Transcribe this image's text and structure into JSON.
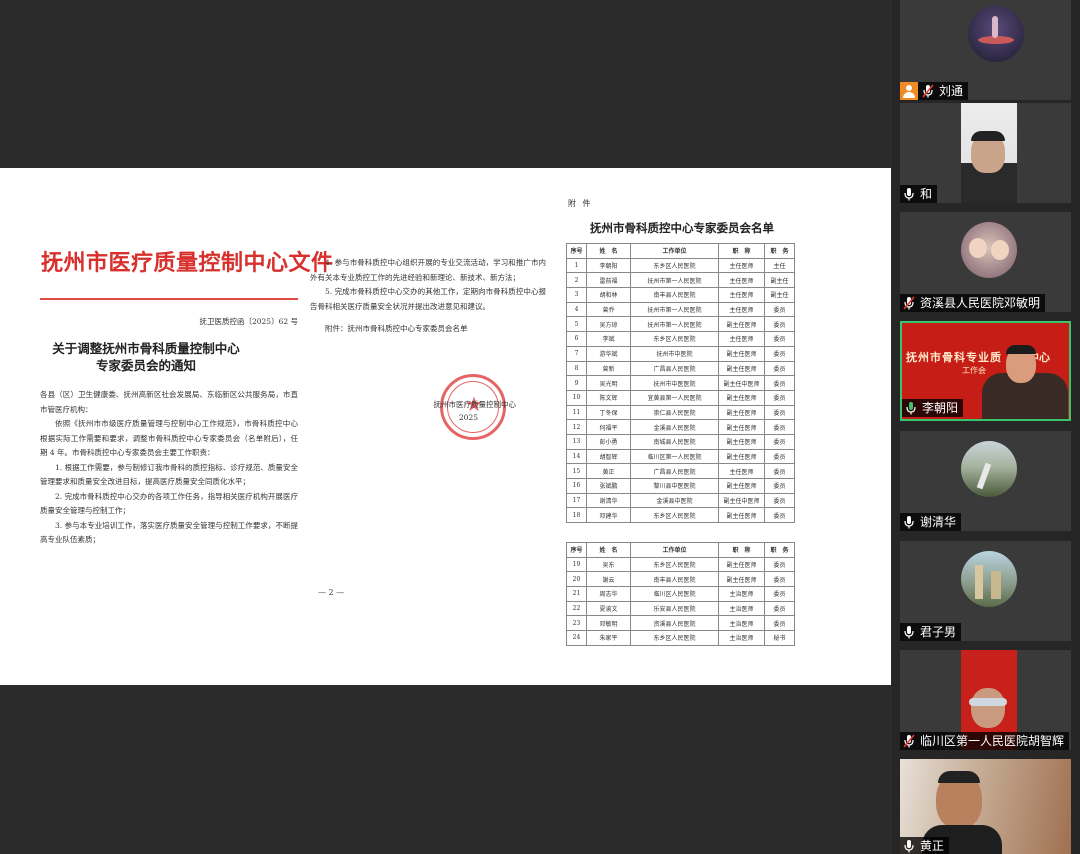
{
  "document": {
    "header_title": "抚州市医疗质量控制中心文件",
    "doc_number": "抚卫医质控函〔2025〕62 号",
    "notice_title_line1": "关于调整抚州市骨科质量控制中心",
    "notice_title_line2": "专家委员会的通知",
    "addressee": "各县（区）卫生健康委、抚州高新区社会发展局、东临新区公共服务局，市直市管医疗机构：",
    "para1": "依照《抚州市市级医疗质量管理与控制中心工作规范》，市骨科质控中心根据实际工作需要和要求，调整市骨科质控中心专家委员会（名单附后），任期 4 年。市骨科质控中心专家委员会主要工作职责：",
    "duty1": "1. 根据工作需要，参与制修订我市骨科的质控指标、诊疗规范、质量安全管理要求和质量安全改进目标，提高医疗质量安全同质化水平；",
    "duty2": "2. 完成市骨科质控中心交办的各项工作任务，指导相关医疗机构开展医疗质量安全管理与控制工作；",
    "duty3": "3. 参与本专业培训工作，落实医疗质量安全管理与控制工作要求，不断提高专业队伍素质；",
    "duty4": "4. 参与市骨科质控中心组织开展的专业交流活动，学习和推广市内外有关本专业质控工作的先进经验和新理论、新技术、新方法；",
    "duty5": "5. 完成市骨科质控中心交办的其他工作，定期向市骨科质控中心报告骨科相关医疗质量安全状况并提出改进意见和建议。",
    "attachment_line": "附件：抚州市骨科质控中心专家委员会名单",
    "signature": "抚州市医疗质量控制中心",
    "sign_date": "2025",
    "page_number": "— 2 —"
  },
  "roster": {
    "attach_label": "附 件",
    "title": "抚州市骨科质控中心专家委员会名单",
    "headers": [
      "序号",
      "姓　名",
      "工作单位",
      "职　称",
      "职　务"
    ],
    "rows1": [
      [
        "1",
        "李朝阳",
        "东乡区人民医院",
        "主任医师",
        "主任"
      ],
      [
        "2",
        "雷前福",
        "抚州市第一人民医院",
        "主任医师",
        "副主任"
      ],
      [
        "3",
        "胡和林",
        "南丰县人民医院",
        "主任医师",
        "副主任"
      ],
      [
        "4",
        "曾乔",
        "抚州市第一人民医院",
        "主任医师",
        "委员"
      ],
      [
        "5",
        "吴方琼",
        "抚州市第一人民医院",
        "副主任医师",
        "委员"
      ],
      [
        "6",
        "李斌",
        "东乡区人民医院",
        "主任医师",
        "委员"
      ],
      [
        "7",
        "游华斌",
        "抚州市中医院",
        "副主任医师",
        "委员"
      ],
      [
        "8",
        "曾新",
        "广昌县人民医院",
        "副主任医师",
        "委员"
      ],
      [
        "9",
        "吴光明",
        "抚州市中医医院",
        "副主任中医师",
        "委员"
      ],
      [
        "10",
        "陈文辉",
        "宜黄县第一人民医院",
        "副主任医师",
        "委员"
      ],
      [
        "11",
        "丁冬保",
        "崇仁县人民医院",
        "副主任医师",
        "委员"
      ],
      [
        "12",
        "何福平",
        "金溪县人民医院",
        "副主任医师",
        "委员"
      ],
      [
        "13",
        "彭小勇",
        "南城县人民医院",
        "副主任医师",
        "委员"
      ],
      [
        "14",
        "胡智辉",
        "临川区第一人民医院",
        "副主任医师",
        "委员"
      ],
      [
        "15",
        "黄正",
        "广昌县人民医院",
        "主任医师",
        "委员"
      ],
      [
        "16",
        "张斌鹏",
        "黎川县中医医院",
        "副主任医师",
        "委员"
      ],
      [
        "17",
        "谢清华",
        "金溪县中医院",
        "副主任中医师",
        "委员"
      ],
      [
        "18",
        "邓建华",
        "东乡区人民医院",
        "副主任医师",
        "委员"
      ]
    ],
    "rows2": [
      [
        "19",
        "吴东",
        "东乡区人民医院",
        "副主任医师",
        "委员"
      ],
      [
        "20",
        "謝云",
        "南丰县人民医院",
        "副主任医师",
        "委员"
      ],
      [
        "21",
        "周志华",
        "临川区人民医院",
        "主治医师",
        "委员"
      ],
      [
        "22",
        "夏渝文",
        "乐安县人民医院",
        "主治医师",
        "委员"
      ],
      [
        "23",
        "邓敏明",
        "资溪县人民医院",
        "主治医师",
        "委员"
      ],
      [
        "24",
        "朱家平",
        "东乡区人民医院",
        "主治医师",
        "秘书"
      ]
    ]
  },
  "participants": [
    {
      "name": "刘通",
      "host": true
    },
    {
      "name": "和",
      "host": false
    },
    {
      "name": "资溪县人民医院邓敏明",
      "host": false
    },
    {
      "name": "李朝阳",
      "host": false,
      "banner_line1": "抚州市骨科专业质",
      "banner_line2": "中心",
      "banner_line3": "工作会"
    },
    {
      "name": "谢清华",
      "host": false
    },
    {
      "name": "君子男",
      "host": false
    },
    {
      "name": "临川区第一人民医院胡智辉",
      "host": false
    },
    {
      "name": "黄正",
      "host": false
    }
  ],
  "colors": {
    "doc_red": "#d8302c",
    "active_speaker_border": "#39c46b",
    "host_badge": "#f08a24"
  }
}
